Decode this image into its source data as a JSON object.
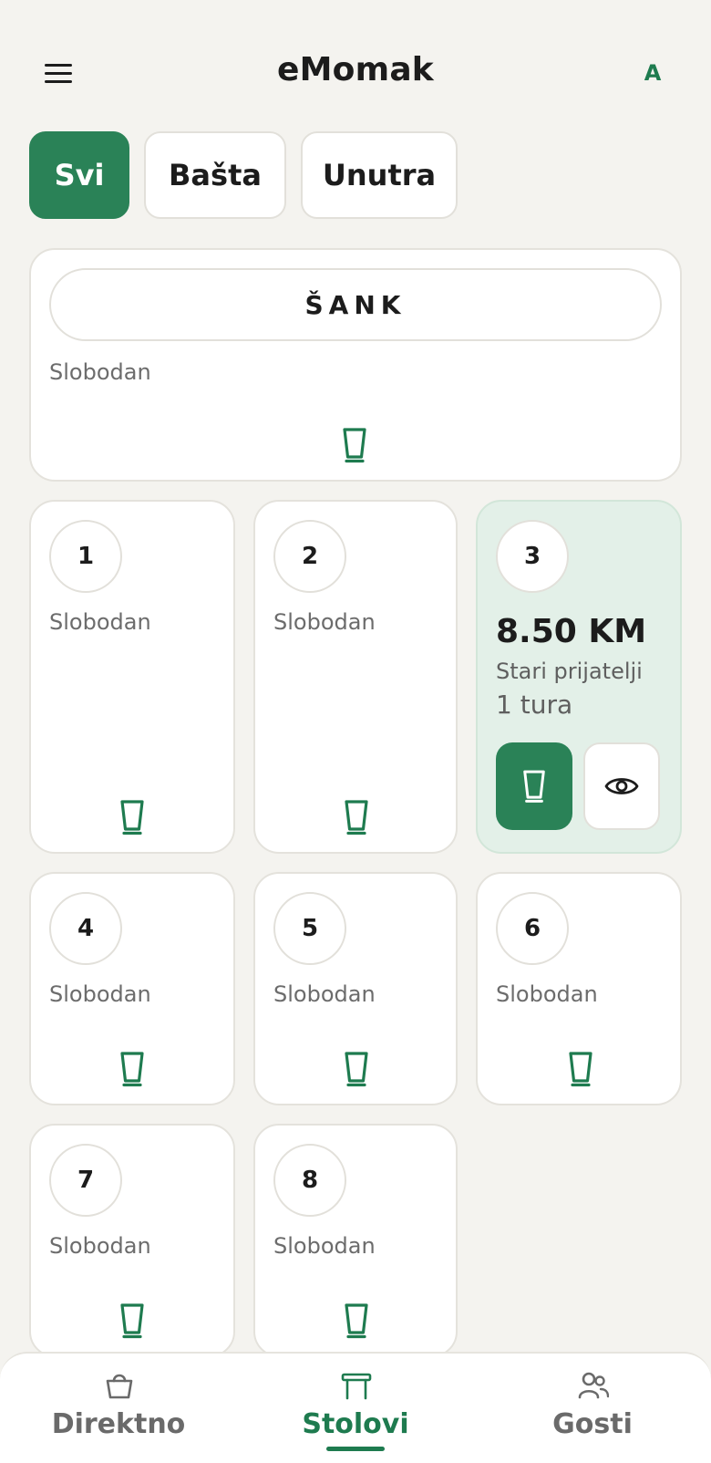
{
  "header": {
    "title": "eMomak",
    "user_initial": "A"
  },
  "filters": [
    {
      "label": "Svi",
      "active": true
    },
    {
      "label": "Bašta",
      "active": false
    },
    {
      "label": "Unutra",
      "active": false
    }
  ],
  "bar": {
    "name": "ŠANK",
    "status": "Slobodan"
  },
  "tables": [
    {
      "number": "1",
      "status": "Slobodan"
    },
    {
      "number": "2",
      "status": "Slobodan"
    },
    {
      "number": "3",
      "amount": "8.50 KM",
      "guest": "Stari prijatelji",
      "rounds": "1 tura"
    },
    {
      "number": "4",
      "status": "Slobodan"
    },
    {
      "number": "5",
      "status": "Slobodan"
    },
    {
      "number": "6",
      "status": "Slobodan"
    },
    {
      "number": "7",
      "status": "Slobodan"
    },
    {
      "number": "8",
      "status": "Slobodan"
    }
  ],
  "nav": {
    "items": [
      {
        "label": "Direktno",
        "icon": "basket-icon",
        "active": false
      },
      {
        "label": "Stolovi",
        "icon": "table-icon",
        "active": true
      },
      {
        "label": "Gosti",
        "icon": "guests-icon",
        "active": false
      }
    ]
  },
  "colors": {
    "accent": "#2a8257",
    "accent_text": "#1e7b4f",
    "busy_card": "#e3f0e8",
    "background": "#f4f3ef"
  }
}
